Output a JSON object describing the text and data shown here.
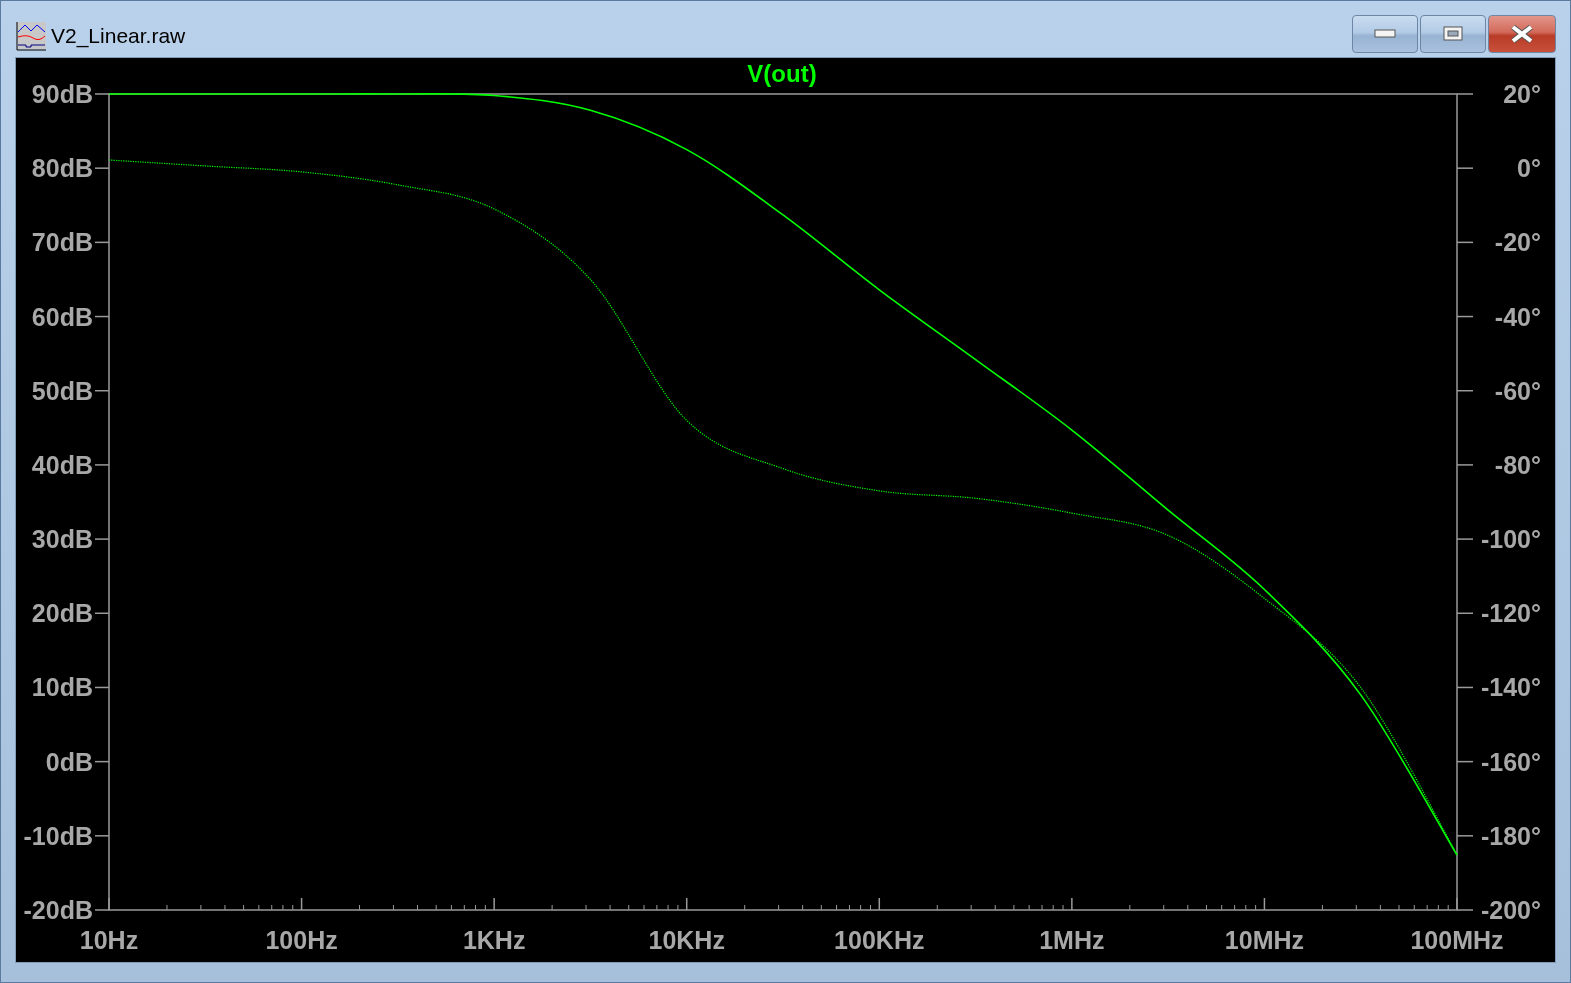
{
  "window": {
    "title": "V2_Linear.raw"
  },
  "plot": {
    "chart_data": {
      "type": "line",
      "title": "V(out)",
      "ylim": [
        -20,
        90
      ],
      "y2lim": [
        -200,
        20
      ],
      "categories": [
        "10Hz",
        null,
        "100Hz",
        null,
        "1KHz",
        null,
        "10KHz",
        null,
        "100KHz",
        null,
        "1MHz",
        null,
        "10MHz",
        null,
        "100MHz"
      ],
      "series": [
        {
          "line_style": "solid",
          "color": "#00ff00",
          "values": [
            90,
            90,
            90,
            90,
            89.8,
            87.8,
            82.5,
            73.7,
            63.6,
            54.2,
            44.7,
            33.9,
            23.2,
            9,
            -12.6
          ]
        },
        {
          "axis": "y2",
          "line_style": "dotted",
          "color": "#00ff00",
          "values": [
            2.2,
            0.6,
            -1,
            -4.5,
            -11,
            -30,
            -68,
            -81,
            -87,
            -89,
            -93,
            -99,
            -116,
            -140,
            -185
          ]
        }
      ],
      "yticks": [
        {
          "value": 90,
          "label": "90dB"
        },
        {
          "value": 80,
          "label": "80dB"
        },
        {
          "value": 70,
          "label": "70dB"
        },
        {
          "value": 60,
          "label": "60dB"
        },
        {
          "value": 50,
          "label": "50dB"
        },
        {
          "value": 40,
          "label": "40dB"
        },
        {
          "value": 30,
          "label": "30dB"
        },
        {
          "value": 20,
          "label": "20dB"
        },
        {
          "value": 10,
          "label": "10dB"
        },
        {
          "value": 0,
          "label": "0dB"
        },
        {
          "value": -10,
          "label": "-10dB"
        },
        {
          "value": -20,
          "label": "-20dB"
        }
      ],
      "y2ticks": [
        {
          "value": 20,
          "label": "20°"
        },
        {
          "value": 0,
          "label": "0°"
        },
        {
          "value": -20,
          "label": "-20°"
        },
        {
          "value": -40,
          "label": "-40°"
        },
        {
          "value": -60,
          "label": "-60°"
        },
        {
          "value": -80,
          "label": "-80°"
        },
        {
          "value": -100,
          "label": "-100°"
        },
        {
          "value": -120,
          "label": "-120°"
        },
        {
          "value": -140,
          "label": "-140°"
        },
        {
          "value": -160,
          "label": "-160°"
        },
        {
          "value": -180,
          "label": "-180°"
        },
        {
          "value": -200,
          "label": "-200°"
        }
      ]
    }
  }
}
